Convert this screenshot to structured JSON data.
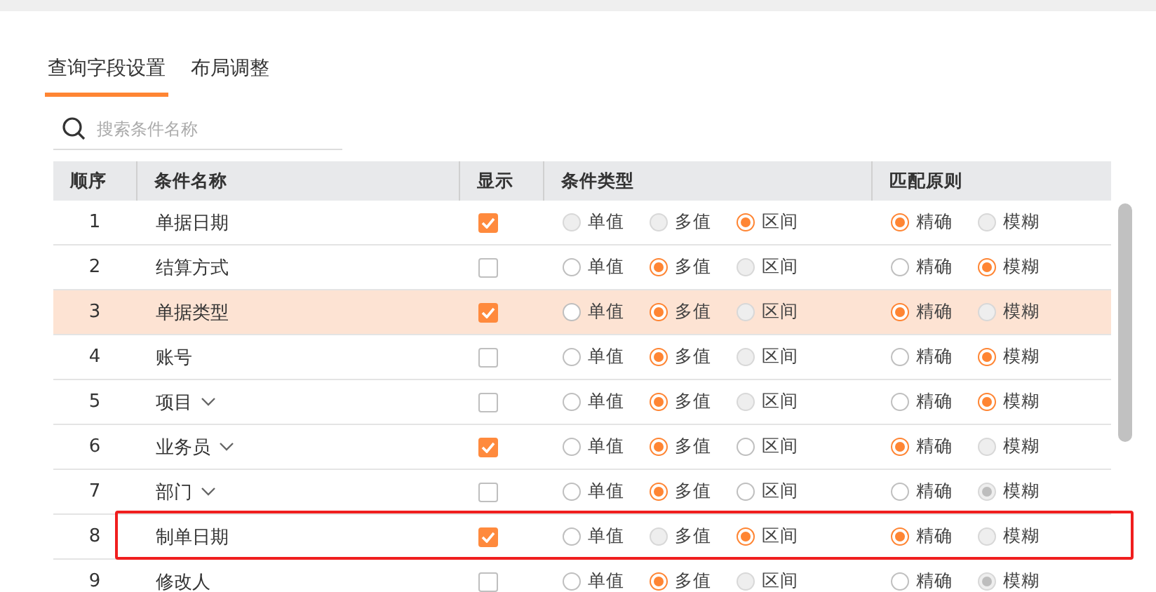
{
  "tabs": [
    {
      "label": "查询字段设置",
      "selected": true
    },
    {
      "label": "布局调整",
      "selected": false
    }
  ],
  "search": {
    "placeholder": "搜索条件名称"
  },
  "table": {
    "columns": [
      "顺序",
      "条件名称",
      "显示",
      "条件类型",
      "匹配原则"
    ],
    "rows": [
      {
        "order": "1",
        "name": "单据日期",
        "expandable": false,
        "shown": true,
        "selected": false,
        "outlined": false,
        "type_options": [
          {
            "label": "单值",
            "selected": false,
            "disabled": true
          },
          {
            "label": "多值",
            "selected": false,
            "disabled": true
          },
          {
            "label": "区间",
            "selected": true,
            "disabled": false
          }
        ],
        "match_options": [
          {
            "label": "精确",
            "selected": true,
            "disabled": false
          },
          {
            "label": "模糊",
            "selected": false,
            "disabled": true
          }
        ]
      },
      {
        "order": "2",
        "name": "结算方式",
        "expandable": false,
        "shown": false,
        "selected": false,
        "outlined": false,
        "type_options": [
          {
            "label": "单值",
            "selected": false,
            "disabled": false
          },
          {
            "label": "多值",
            "selected": true,
            "disabled": false
          },
          {
            "label": "区间",
            "selected": false,
            "disabled": true
          }
        ],
        "match_options": [
          {
            "label": "精确",
            "selected": false,
            "disabled": false
          },
          {
            "label": "模糊",
            "selected": true,
            "disabled": false
          }
        ]
      },
      {
        "order": "3",
        "name": "单据类型",
        "expandable": false,
        "shown": true,
        "selected": true,
        "outlined": false,
        "type_options": [
          {
            "label": "单值",
            "selected": false,
            "disabled": false
          },
          {
            "label": "多值",
            "selected": true,
            "disabled": false
          },
          {
            "label": "区间",
            "selected": false,
            "disabled": true
          }
        ],
        "match_options": [
          {
            "label": "精确",
            "selected": true,
            "disabled": false
          },
          {
            "label": "模糊",
            "selected": false,
            "disabled": true
          }
        ]
      },
      {
        "order": "4",
        "name": "账号",
        "expandable": false,
        "shown": false,
        "selected": false,
        "outlined": false,
        "type_options": [
          {
            "label": "单值",
            "selected": false,
            "disabled": false
          },
          {
            "label": "多值",
            "selected": true,
            "disabled": false
          },
          {
            "label": "区间",
            "selected": false,
            "disabled": true
          }
        ],
        "match_options": [
          {
            "label": "精确",
            "selected": false,
            "disabled": false
          },
          {
            "label": "模糊",
            "selected": true,
            "disabled": false
          }
        ]
      },
      {
        "order": "5",
        "name": "项目",
        "expandable": true,
        "shown": false,
        "selected": false,
        "outlined": false,
        "type_options": [
          {
            "label": "单值",
            "selected": false,
            "disabled": false
          },
          {
            "label": "多值",
            "selected": true,
            "disabled": false
          },
          {
            "label": "区间",
            "selected": false,
            "disabled": true
          }
        ],
        "match_options": [
          {
            "label": "精确",
            "selected": false,
            "disabled": false
          },
          {
            "label": "模糊",
            "selected": true,
            "disabled": false
          }
        ]
      },
      {
        "order": "6",
        "name": "业务员",
        "expandable": true,
        "shown": true,
        "selected": false,
        "outlined": false,
        "type_options": [
          {
            "label": "单值",
            "selected": false,
            "disabled": false
          },
          {
            "label": "多值",
            "selected": true,
            "disabled": false
          },
          {
            "label": "区间",
            "selected": false,
            "disabled": false
          }
        ],
        "match_options": [
          {
            "label": "精确",
            "selected": true,
            "disabled": false
          },
          {
            "label": "模糊",
            "selected": false,
            "disabled": true
          }
        ]
      },
      {
        "order": "7",
        "name": "部门",
        "expandable": true,
        "shown": false,
        "selected": false,
        "outlined": false,
        "type_options": [
          {
            "label": "单值",
            "selected": false,
            "disabled": false
          },
          {
            "label": "多值",
            "selected": true,
            "disabled": false
          },
          {
            "label": "区间",
            "selected": false,
            "disabled": false
          }
        ],
        "match_options": [
          {
            "label": "精确",
            "selected": false,
            "disabled": false
          },
          {
            "label": "模糊",
            "selected": true,
            "disabled": true
          }
        ]
      },
      {
        "order": "8",
        "name": "制单日期",
        "expandable": false,
        "shown": true,
        "selected": false,
        "outlined": true,
        "type_options": [
          {
            "label": "单值",
            "selected": false,
            "disabled": false
          },
          {
            "label": "多值",
            "selected": false,
            "disabled": true
          },
          {
            "label": "区间",
            "selected": true,
            "disabled": false
          }
        ],
        "match_options": [
          {
            "label": "精确",
            "selected": true,
            "disabled": false
          },
          {
            "label": "模糊",
            "selected": false,
            "disabled": true
          }
        ]
      },
      {
        "order": "9",
        "name": "修改人",
        "expandable": false,
        "shown": false,
        "selected": false,
        "outlined": false,
        "type_options": [
          {
            "label": "单值",
            "selected": false,
            "disabled": false
          },
          {
            "label": "多值",
            "selected": true,
            "disabled": false
          },
          {
            "label": "区间",
            "selected": false,
            "disabled": true
          }
        ],
        "match_options": [
          {
            "label": "精确",
            "selected": false,
            "disabled": false
          },
          {
            "label": "模糊",
            "selected": true,
            "disabled": true
          }
        ]
      }
    ]
  }
}
